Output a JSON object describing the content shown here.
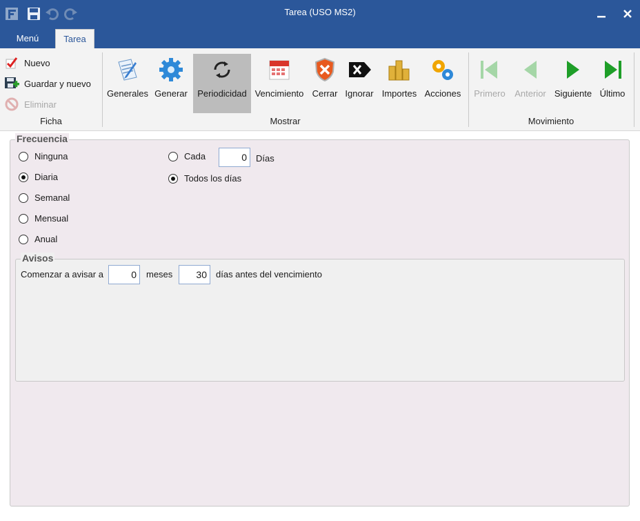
{
  "window": {
    "title": "Tarea (USO MS2)",
    "minimize_icon": "minimize-icon",
    "close_icon": "close-icon",
    "logo_icon": "app-logo-icon",
    "quick_access": [
      "save-icon",
      "undo-icon",
      "redo-icon"
    ]
  },
  "tabs": [
    {
      "label": "Menú",
      "active": false
    },
    {
      "label": "Tarea",
      "active": true
    }
  ],
  "ribbon": {
    "ficha": {
      "label": "Ficha",
      "items": [
        {
          "label": "Nuevo",
          "icon": "check-icon",
          "enabled": true
        },
        {
          "label": "Guardar y nuevo",
          "icon": "save-add-icon",
          "enabled": true
        },
        {
          "label": "Eliminar",
          "icon": "delete-icon",
          "enabled": false
        }
      ]
    },
    "mostrar": {
      "label": "Mostrar",
      "items": [
        {
          "label": "Generales",
          "icon": "document-edit-icon"
        },
        {
          "label": "Generar",
          "icon": "gear-icon"
        },
        {
          "label": "Periodicidad",
          "icon": "refresh-icon",
          "selected": true
        },
        {
          "label": "Vencimiento",
          "icon": "calendar-icon"
        },
        {
          "label": "Cerrar",
          "icon": "shield-close-icon"
        },
        {
          "label": "Ignorar",
          "icon": "ignore-icon"
        },
        {
          "label": "Importes",
          "icon": "coins-icon"
        },
        {
          "label": "Acciones",
          "icon": "gears-icon"
        }
      ]
    },
    "movimiento": {
      "label": "Movimiento",
      "items": [
        {
          "label": "Primero",
          "icon": "first-icon",
          "enabled": false
        },
        {
          "label": "Anterior",
          "icon": "previous-icon",
          "enabled": false
        },
        {
          "label": "Siguiente",
          "icon": "next-icon",
          "enabled": true
        },
        {
          "label": "Último",
          "icon": "last-icon",
          "enabled": true
        }
      ]
    }
  },
  "frecuencia": {
    "title": "Frecuencia",
    "options": [
      {
        "label": "Ninguna",
        "checked": false
      },
      {
        "label": "Diaria",
        "checked": true
      },
      {
        "label": "Semanal",
        "checked": false
      },
      {
        "label": "Mensual",
        "checked": false
      },
      {
        "label": "Anual",
        "checked": false
      }
    ],
    "cada": {
      "label": "Cada",
      "value": "0",
      "unit": "Días",
      "checked": false
    },
    "todos": {
      "label": "Todos los días",
      "checked": true
    }
  },
  "avisos": {
    "title": "Avisos",
    "prefix": "Comenzar a avisar a",
    "months_value": "0",
    "months_label": "meses",
    "days_value": "30",
    "days_label": "días antes del vencimiento"
  },
  "colors": {
    "titlebar": "#2b579a",
    "ribbon": "#f3f3f3",
    "panel": "#f0e9ee",
    "accent_green": "#2ca02c"
  }
}
